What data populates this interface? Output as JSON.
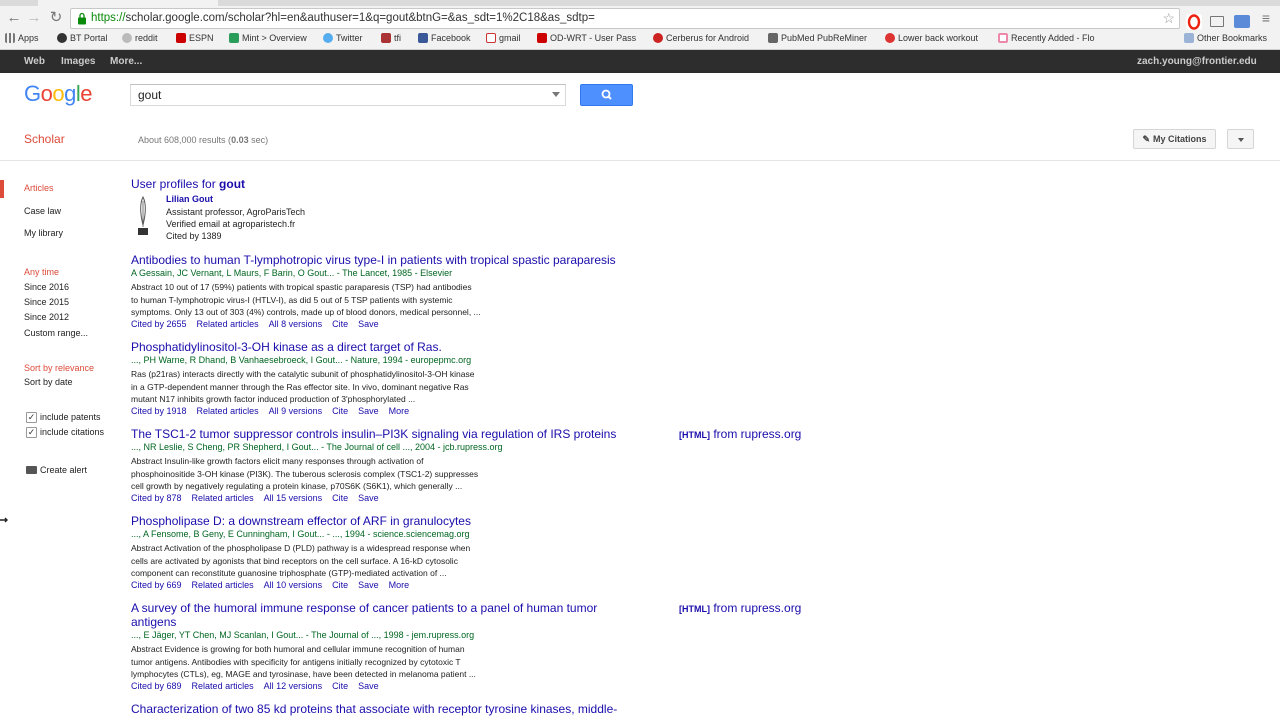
{
  "browser": {
    "url": "https://scholar.google.com/scholar?hl=en&authuser=1&q=gout&btnG=&as_sdt=1%2C18&as_sdtp=",
    "url_scheme": "https://",
    "url_rest": "scholar.google.com/scholar?hl=en&authuser=1&q=gout&btnG=&as_sdt=1%2C18&as_sdtp=",
    "bookmarks": [
      "Apps",
      "BT Portal",
      "reddit",
      "ESPN",
      "Mint > Overview",
      "Twitter",
      "tfi",
      "Facebook",
      "gmail",
      "OD-WRT - User Pass",
      "Cerberus for Android",
      "PubMed PubReMiner",
      "Lower back workout",
      "Recently Added - Flo",
      "Other Bookmarks"
    ]
  },
  "gbar": {
    "web": "Web",
    "images": "Images",
    "more": "More...",
    "account": "zach.young@frontier.edu"
  },
  "header": {
    "logo": "Google",
    "query": "gout",
    "scholar": "Scholar",
    "results_count": "About 608,000 results (",
    "results_time": "0.03",
    "results_tail": " sec)",
    "my_citations": "My Citations"
  },
  "sidebar": {
    "articles": "Articles",
    "case_law": "Case law",
    "my_library": "My library",
    "any_time": "Any time",
    "since_2016": "Since 2016",
    "since_2015": "Since 2015",
    "since_2012": "Since 2012",
    "custom_range": "Custom range...",
    "sort_relevance": "Sort by relevance",
    "sort_date": "Sort by date",
    "include_patents": "include patents",
    "include_citations": "include citations",
    "create_alert": "Create alert"
  },
  "profiles": {
    "heading_prefix": "User profiles for ",
    "heading_query": "gout",
    "name": "Lilian Gout",
    "title": "Assistant professor, AgroParisTech",
    "email": "Verified email at agroparistech.fr",
    "cited": "Cited by 1389"
  },
  "results": [
    {
      "title": "Antibodies to human T-lymphotropic virus type-I in patients with tropical spastic paraparesis",
      "authors": "A Gessain, JC Vernant, L Maurs, F Barin, O Gout... - The Lancet, 1985 - Elsevier",
      "snippet1": "Abstract 10 out of 17 (59%) patients with tropical spastic paraparesis (TSP) had antibodies",
      "snippet2": "to human T-lymphotropic virus-I (HTLV-I), as did 5 out of 5 TSP patients with systemic",
      "snippet3": "symptoms. Only 13 out of 303 (4%) controls, made up of blood donors, medical personnel, ...",
      "snippet4": "",
      "cited": "Cited by 2655",
      "related": "Related articles",
      "versions": "All 8 versions",
      "cite": "Cite",
      "save": "Save",
      "more": ""
    },
    {
      "title": "Phosphatidylinositol-3-OH kinase as a direct target of Ras.",
      "authors": "..., PH Warne, R Dhand, B Vanhaesebroeck, I Gout... - Nature, 1994 - europepmc.org",
      "snippet1": "Ras (p21ras) interacts directly with the catalytic subunit of phosphatidylinositol-3-OH kinase",
      "snippet2": "in a GTP-dependent manner through the Ras effector site. In vivo, dominant negative Ras",
      "snippet3": "mutant N17 inhibits growth factor induced production of 3'phosphorylated ...",
      "snippet4": "",
      "cited": "Cited by 1918",
      "related": "Related articles",
      "versions": "All 9 versions",
      "cite": "Cite",
      "save": "Save",
      "more": "More"
    },
    {
      "title": "The TSC1-2 tumor suppressor controls insulin–PI3K signaling via regulation of IRS proteins",
      "authors": "..., NR Leslie, S Cheng, PR Shepherd, I Gout... - The Journal of cell ..., 2004 - jcb.rupress.org",
      "snippet1": "Abstract Insulin-like growth factors elicit many responses through activation of",
      "snippet2": "phosphoinositide 3-OH kinase (PI3K). The tuberous sclerosis complex (TSC1-2) suppresses",
      "snippet3": "cell growth by negatively regulating a protein kinase, p70S6K (S6K1), which generally ...",
      "snippet4": "",
      "cited": "Cited by 878",
      "related": "Related articles",
      "versions": "All 15 versions",
      "cite": "Cite",
      "save": "Save",
      "more": "",
      "side_tag": "[HTML]",
      "side_src": " from rupress.org"
    },
    {
      "title": "Phospholipase D: a downstream effector of ARF in granulocytes",
      "authors": "..., A Fensome, B Geny, E Cunningham, I Gout... - ..., 1994 - science.sciencemag.org",
      "snippet1": "Abstract Activation of the phospholipase D (PLD) pathway is a widespread response when",
      "snippet2": "cells are activated by agonists that bind receptors on the cell surface. A 16-kD cytosolic",
      "snippet3": "component can reconstitute guanosine triphosphate (GTP)-mediated activation of ...",
      "snippet4": "",
      "cited": "Cited by 669",
      "related": "Related articles",
      "versions": "All 10 versions",
      "cite": "Cite",
      "save": "Save",
      "more": "More"
    },
    {
      "title": "A survey of the humoral immune response of cancer patients to a panel of human tumor",
      "title2": "antigens",
      "authors": "..., E Jäger, YT Chen, MJ Scanlan, I Gout... - The Journal of ..., 1998 - jem.rupress.org",
      "snippet1": "Abstract Evidence is growing for both humoral and cellular immune recognition of human",
      "snippet2": "tumor antigens. Antibodies with specificity for antigens initially recognized by cytotoxic T",
      "snippet3": "lymphocytes (CTLs), eg, MAGE and tyrosinase, have been detected in melanoma patient ...",
      "snippet4": "",
      "cited": "Cited by 689",
      "related": "Related articles",
      "versions": "All 12 versions",
      "cite": "Cite",
      "save": "Save",
      "more": "",
      "side_tag": "[HTML]",
      "side_src": " from rupress.org"
    },
    {
      "title": "Characterization of two 85 kd proteins that associate with receptor tyrosine kinases, middle-"
    }
  ]
}
